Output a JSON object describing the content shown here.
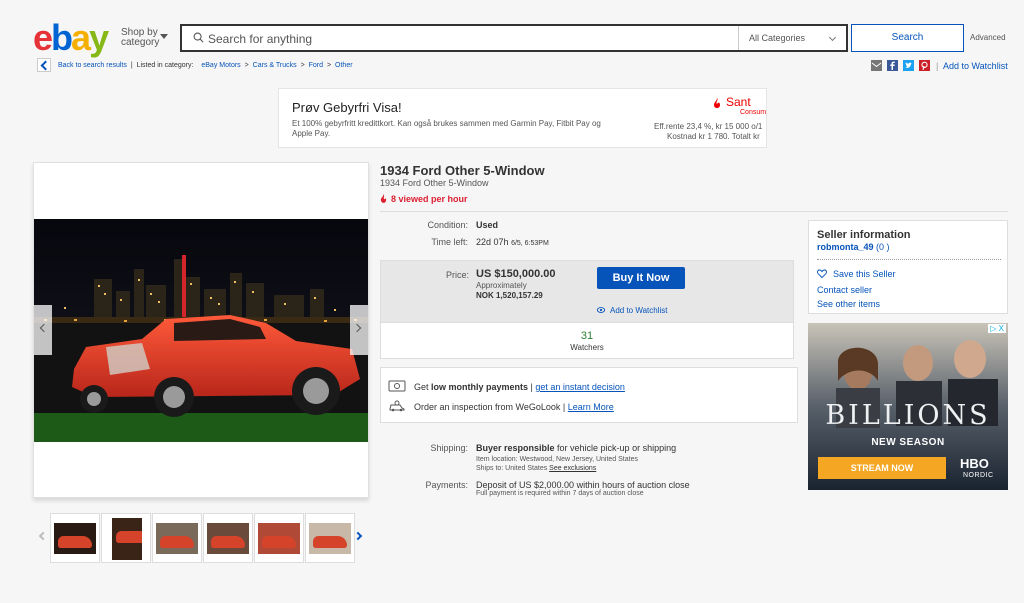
{
  "header": {
    "logo_letters": [
      "e",
      "b",
      "a",
      "y"
    ],
    "shop_by_line1": "Shop by",
    "shop_by_line2": "category",
    "search_placeholder": "Search for anything",
    "category_selected": "All Categories",
    "search_button": "Search",
    "advanced_link": "Advanced"
  },
  "breadcrumb": {
    "back_link": "Back to search results",
    "listed_in": "Listed in category:",
    "items": [
      "eBay Motors",
      "Cars & Trucks",
      "Ford",
      "Other"
    ],
    "add_to_watchlist": "Add to Watchlist"
  },
  "share_icons": [
    "email-icon",
    "facebook-icon",
    "twitter-icon",
    "pinterest-icon"
  ],
  "banner_ad": {
    "title": "Prøv Gebyrfri Visa!",
    "description": "Et 100% gebyrfritt kredittkort. Kan også brukes sammen med Garmin Pay, Fitbit Pay og Apple Pay.",
    "brand": "Sant",
    "brand_sub": "Consum",
    "terms_line1": "Eff.rente 23,4 %, kr 15 000 o/1",
    "terms_line2": "Kostnad kr 1 780. Totalt kr"
  },
  "item": {
    "title": "1934 Ford Other 5-Window",
    "subtitle": "1934 Ford Other 5-Window",
    "viewed": "8 viewed per hour",
    "condition_label": "Condition:",
    "condition_value": "Used",
    "time_left_label": "Time left:",
    "time_left_value": "22d 07h",
    "time_left_date": "6/5, 6:53PM",
    "price_label": "Price:",
    "price": "US $150,000.00",
    "approx_label": "Approximately",
    "approx_value": "NOK 1,520,157.29",
    "buy_now": "Buy It Now",
    "add_to_watchlist": "Add to Watchlist",
    "watchers_count": "31",
    "watchers_label": "Watchers"
  },
  "financing": {
    "row1_prefix": "Get ",
    "row1_bold": "low monthly payments",
    "row1_sep": " | ",
    "row1_link": "get an instant decision",
    "row2_text": "Order an inspection from WeGoLook",
    "row2_sep": " | ",
    "row2_link": "Learn More"
  },
  "shipping": {
    "label": "Shipping:",
    "bold": "Buyer responsible",
    "rest": " for vehicle pick-up or shipping",
    "item_location": "Item location:  Westwood, New Jersey, United States",
    "ships_to_prefix": "Ships to:  United States  ",
    "ships_to_link": "See exclusions"
  },
  "payments": {
    "label": "Payments:",
    "line1": "Deposit of US $2,000.00 within  hours of auction close",
    "line2": "Full payment is required within 7 days of auction close"
  },
  "seller": {
    "heading": "Seller information",
    "name": "robmonta_49",
    "feedback": "(0 )",
    "save_seller": "Save this Seller",
    "contact_seller": "Contact seller",
    "see_other_items": "See other items"
  },
  "side_ad": {
    "title": "BILLIONS",
    "subtitle": "NEW SEASON",
    "cta": "STREAM NOW",
    "brand_line1": "HBO",
    "brand_line2": "NORDIC",
    "ad_choices": "▷ X"
  },
  "colors": {
    "link": "#0654ba",
    "buy_button": "#0654ba",
    "viewed_red": "#dd1e31",
    "ad_cta": "#f5a623"
  }
}
